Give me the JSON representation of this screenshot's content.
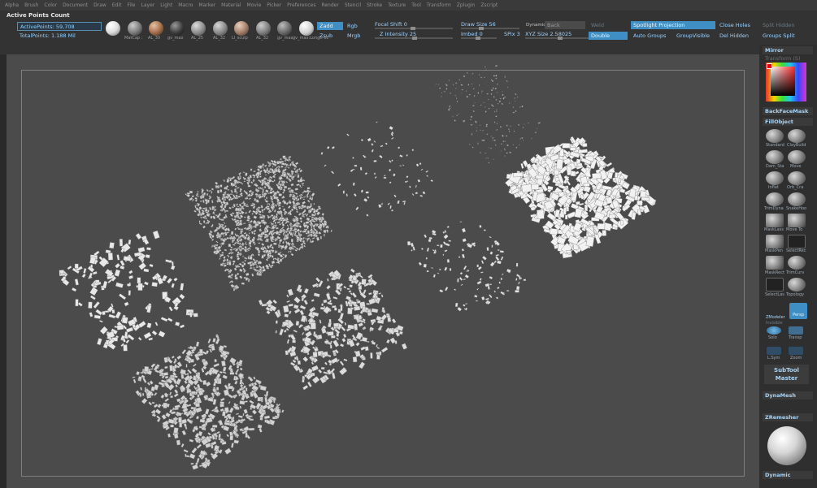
{
  "menu": [
    "Alpha",
    "Brush",
    "Color",
    "Document",
    "Draw",
    "Edit",
    "File",
    "Layer",
    "Light",
    "Macro",
    "Marker",
    "Material",
    "Movie",
    "Picker",
    "Preferences",
    "Render",
    "Stencil",
    "Stroke",
    "Texture",
    "Tool",
    "Transform",
    "Zplugin",
    "Zscript"
  ],
  "top": {
    "title": "Active Points Count",
    "active_points": "ActivePoints: 59,708",
    "total_points": "TotalPoints: 1.188 Mil",
    "materials": [
      "",
      "MatCap :",
      "AL_30",
      "gv_max",
      "AL_25",
      "AL_32",
      "LI_sculp",
      "AL_32",
      "gv_max",
      "gv_max:Longtr-sc"
    ],
    "zadd": "Zadd",
    "zsub": "Zsub",
    "rgb": "Rgb",
    "mrgb": "Mrgb",
    "focal_shift": "Focal Shift 0",
    "z_intensity": "Z Intensity 25",
    "draw_size": "Draw Size 56",
    "imbed": "Imbed 0",
    "spix": "SPix 3",
    "dynamic": "Dynamic",
    "back": "Back",
    "xyz_size": "XYZ Size 2.58025",
    "double": "Double",
    "mirror_hidden": "Weld",
    "spotlight": "Spotlight Projection",
    "auto_groups": "Auto Groups",
    "group_visible": "GroupVisible",
    "close_holes": "Close Holes",
    "del_hidden": "Del Hidden",
    "split_hidden": "Split Hidden",
    "groups_split": "Groups Split"
  },
  "right_panel": {
    "mirror": "Mirror",
    "mirror_sub": "Transform (S)",
    "backface": "BackFaceMask",
    "fillobject": "FillObject",
    "tools": [
      {
        "a": "Standard",
        "b": "ClayBuild"
      },
      {
        "a": "Dam_Sta",
        "b": "Move"
      },
      {
        "a": "Inflat",
        "b": "Orb_Cra"
      },
      {
        "a": "TrimDyna",
        "b": "SnakeHoo"
      },
      {
        "a": "MaskLass",
        "b": "Move To"
      },
      {
        "a": "MaskPen",
        "b": "SelectRec"
      },
      {
        "a": "MaskRect",
        "b": "TrimCurv"
      },
      {
        "a": "SelectLas",
        "b": "Topology"
      }
    ],
    "persp": "Persp",
    "zmodeler": "ZModeler",
    "zmodeler_sub": "Invisible",
    "solo": "Solo",
    "transp": "Transp",
    "lsym": "L.Sym",
    "zoom": "Zoom",
    "subtool_master": "SubTool Master",
    "dynamesh": "DynaMesh",
    "zremesher": "ZRemesher",
    "dynamic": "Dynamic"
  }
}
